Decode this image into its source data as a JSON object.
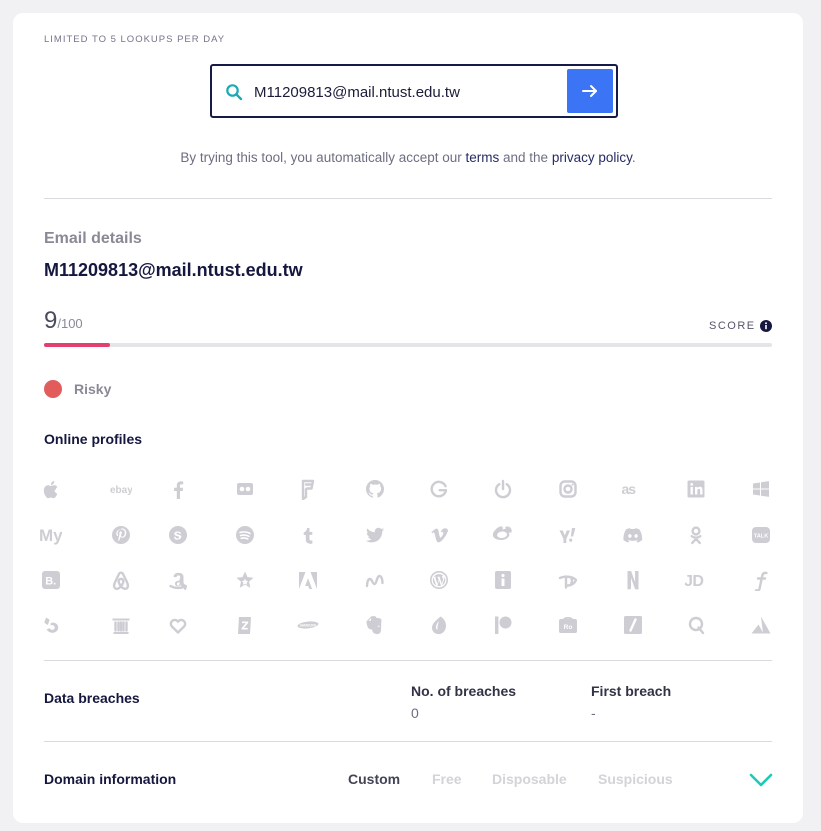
{
  "limit_notice": "LIMITED TO 5 LOOKUPS PER DAY",
  "search": {
    "value": "M11209813@mail.ntust.edu.tw",
    "icon": "search-icon",
    "submit_icon": "arrow-right-icon"
  },
  "accept": {
    "prefix": "By trying this tool, you automatically accept our ",
    "terms": "terms",
    "middle": " and the ",
    "privacy": "privacy policy",
    "suffix": "."
  },
  "email_details": {
    "label": "Email details",
    "email": "M11209813@mail.ntust.edu.tw",
    "score": "9",
    "score_max": "/100",
    "score_label": "SCORE",
    "score_fraction": 0.09,
    "status": "Risky",
    "status_color": "#e25c5c"
  },
  "online_profiles": {
    "label": "Online profiles",
    "icons": [
      "apple-icon",
      "ebay-icon",
      "facebook-icon",
      "flickr-icon",
      "foursquare-icon",
      "github-icon",
      "google-icon",
      "gravatar-icon",
      "instagram-icon",
      "lastfm-icon",
      "linkedin-icon",
      "microsoft-icon",
      "myspace-icon",
      "pinterest-icon",
      "skype-icon",
      "spotify-icon",
      "tumblr-icon",
      "twitter-icon",
      "vimeo-icon",
      "weibo-icon",
      "yahoo-icon",
      "discord-icon",
      "ok-icon",
      "kakao-icon",
      "booking-icon",
      "airbnb-icon",
      "amazon-icon",
      "archive-star-icon",
      "adobe-icon",
      "envato-icon",
      "wordpress-icon",
      "imdb-icon",
      "disney-icon",
      "netflix-icon",
      "jd-icon",
      "flipkart-icon",
      "bukalapak-icon",
      "archive-icon",
      "hearts-icon",
      "zoho-icon",
      "samsung-icon",
      "evernote-icon",
      "ello-icon",
      "patreon-icon",
      "vk-icon",
      "slash-icon",
      "qzone-icon",
      "atlassian-icon"
    ],
    "icon_texts": {
      "ebay": "ebay",
      "myspace": "My",
      "jd": "JD",
      "lastfm": "as",
      "booking": "B.",
      "kakao": "TALK",
      "samsung": "SAMSUNG"
    }
  },
  "breaches": {
    "label": "Data breaches",
    "count_head": "No. of breaches",
    "count_value": "0",
    "first_head": "First breach",
    "first_value": "-"
  },
  "domain": {
    "label": "Domain information",
    "tags": [
      "Custom",
      "Free",
      "Disposable",
      "Suspicious"
    ],
    "active_tag": "Custom",
    "expand_icon": "chevron-down-icon"
  },
  "colors": {
    "accent": "#3b74f5",
    "score_bar": "#e4406e",
    "chevron": "#1ec9b7",
    "search_icon": "#1aa9b5"
  }
}
